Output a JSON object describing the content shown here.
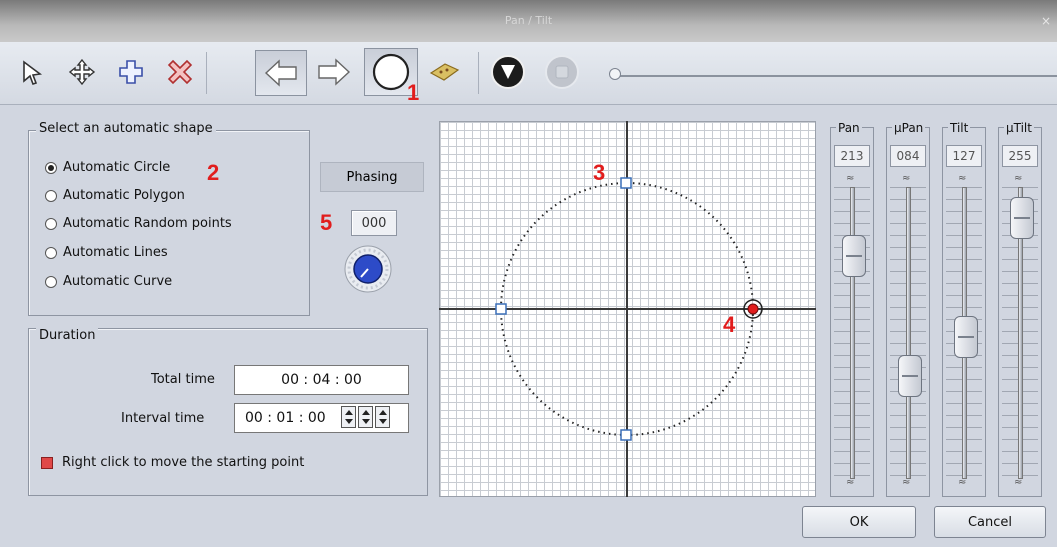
{
  "window": {
    "title": "Pan / Tilt",
    "close_glyph": "×"
  },
  "toolbar": {
    "icons": [
      "select-arrow-icon",
      "move-cross-icon",
      "add-point-icon",
      "delete-point-icon",
      "previous-arrow-icon",
      "next-arrow-icon",
      "circle-shape-icon",
      "map-icon",
      "play-icon",
      "stop-icon"
    ],
    "speed_slider_value": 0
  },
  "markers": {
    "m1": "1",
    "m2": "2",
    "m3": "3",
    "m4": "4",
    "m5": "5"
  },
  "shape_group": {
    "label": "Select an automatic shape",
    "options": [
      "Automatic Circle",
      "Automatic Polygon",
      "Automatic Random points",
      "Automatic Lines",
      "Automatic Curve"
    ],
    "selected": "Automatic Circle"
  },
  "phasing": {
    "label": "Phasing",
    "value": "000"
  },
  "duration": {
    "label": "Duration",
    "total_label": "Total time",
    "total_value": "00 : 04 : 00",
    "interval_label": "Interval time",
    "interval_value": "00 : 01 : 00",
    "hint": "Right click to move the starting point"
  },
  "channels": [
    {
      "name": "Pan",
      "value": "213"
    },
    {
      "name": "µPan",
      "value": "084"
    },
    {
      "name": "Tilt",
      "value": "127"
    },
    {
      "name": "µTilt",
      "value": "255"
    }
  ],
  "buttons": {
    "ok": "OK",
    "cancel": "Cancel"
  },
  "colors": {
    "accent_red": "#e11d1d",
    "point_blue": "#3a6fb8"
  }
}
